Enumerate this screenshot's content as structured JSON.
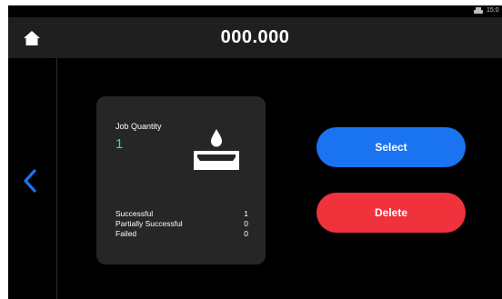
{
  "status": {
    "text": "15:0",
    "icon": "printer-icon"
  },
  "header": {
    "title": "000.000",
    "home_icon": "home-icon"
  },
  "nav": {
    "back_icon": "chevron-left-icon"
  },
  "job_card": {
    "quantity_label": "Job Quantity",
    "quantity_value": "1",
    "icon": "tray-with-drop-icon",
    "stats": [
      {
        "label": "Successful",
        "value": "1"
      },
      {
        "label": "Partially Successful",
        "value": "0"
      },
      {
        "label": "Failed",
        "value": "0"
      }
    ]
  },
  "actions": {
    "select_label": "Select",
    "delete_label": "Delete"
  },
  "colors": {
    "background": "#000000",
    "titlebar": "#1f1f1f",
    "card": "#262626",
    "accent_green": "#2ee07a",
    "select_blue": "#1a73f0",
    "delete_red": "#f0323c",
    "back_arrow_blue": "#1a73f0"
  }
}
